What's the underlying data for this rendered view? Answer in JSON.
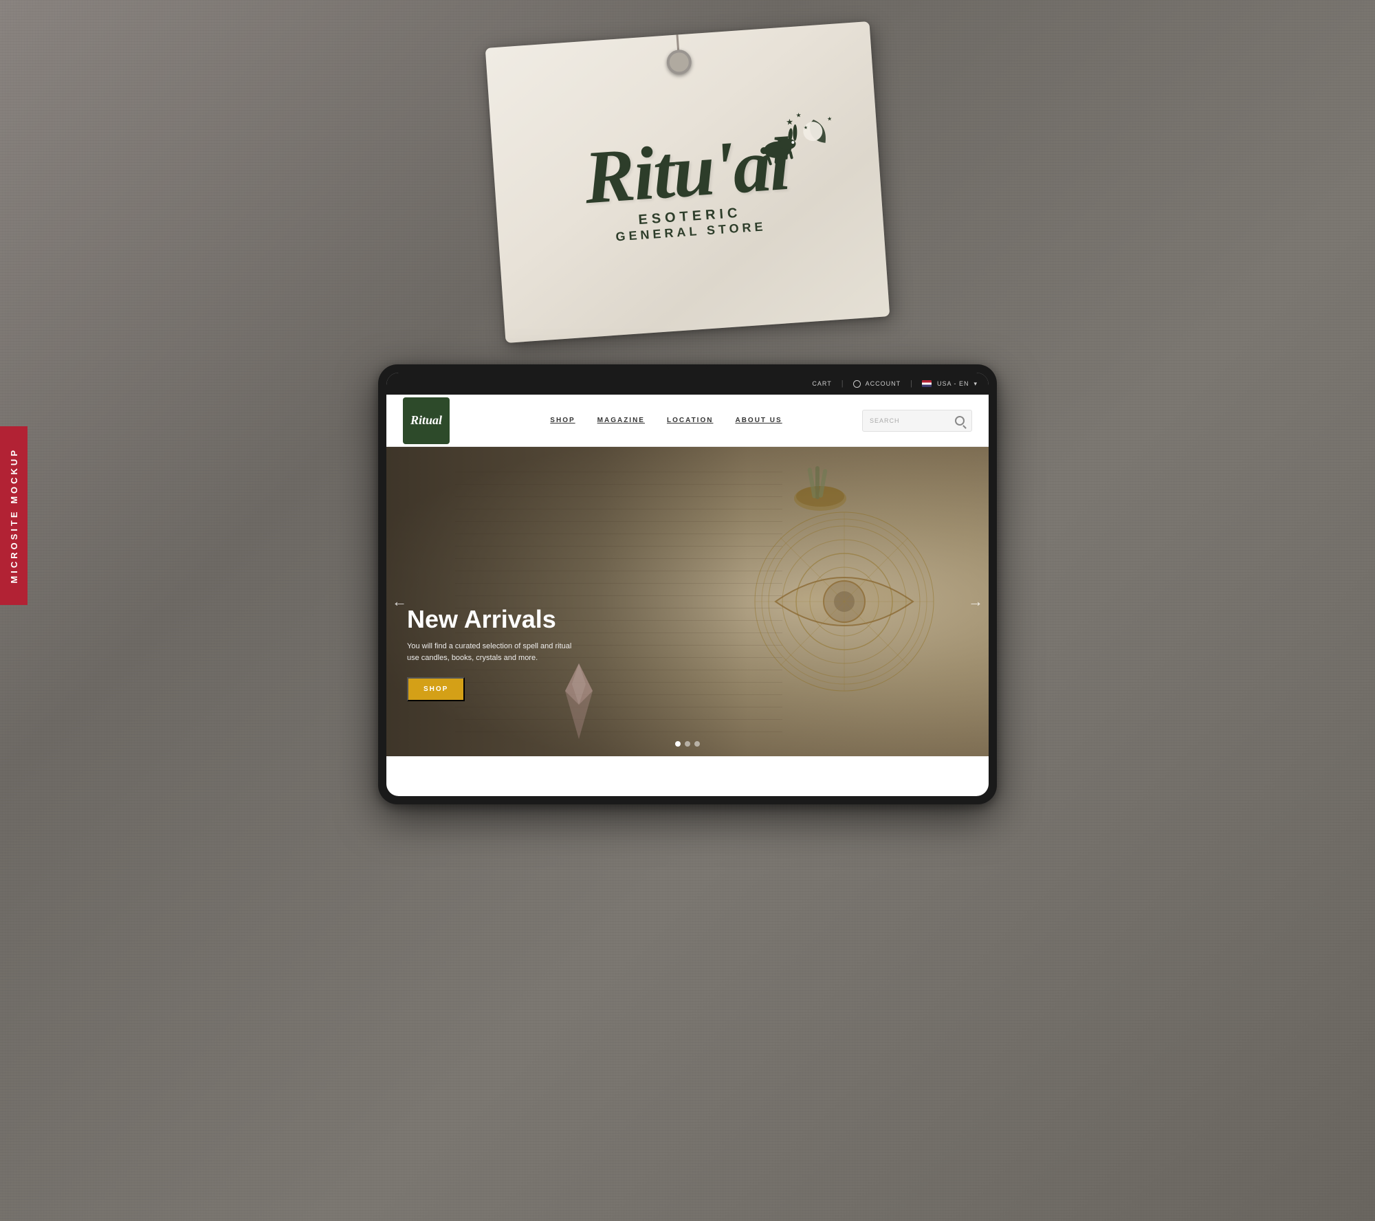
{
  "background": {
    "color": "#7a7670"
  },
  "tag": {
    "brand_main": "Ritu'al",
    "subtitle1": "Esoteric",
    "subtitle2": "General Store"
  },
  "microsite_label": {
    "text": "Microsite Mockup"
  },
  "topbar": {
    "cart_label": "Cart",
    "account_label": "Account",
    "locale_label": "USA - EN",
    "locale_arrow": "▾"
  },
  "navbar": {
    "logo_text": "Ritual",
    "links": [
      "Shop",
      "Magazine",
      "Location",
      "About Us"
    ],
    "search_placeholder": "Search"
  },
  "hero": {
    "title": "New Arrivals",
    "description": "You will find a curated selection of spell and ritual use candles, books, crystals and more.",
    "cta_label": "SHOP",
    "prev_arrow": "←",
    "next_arrow": "→",
    "dots": [
      {
        "active": true
      },
      {
        "active": false
      },
      {
        "active": false
      }
    ]
  },
  "about_us_text": "ABOUT US"
}
